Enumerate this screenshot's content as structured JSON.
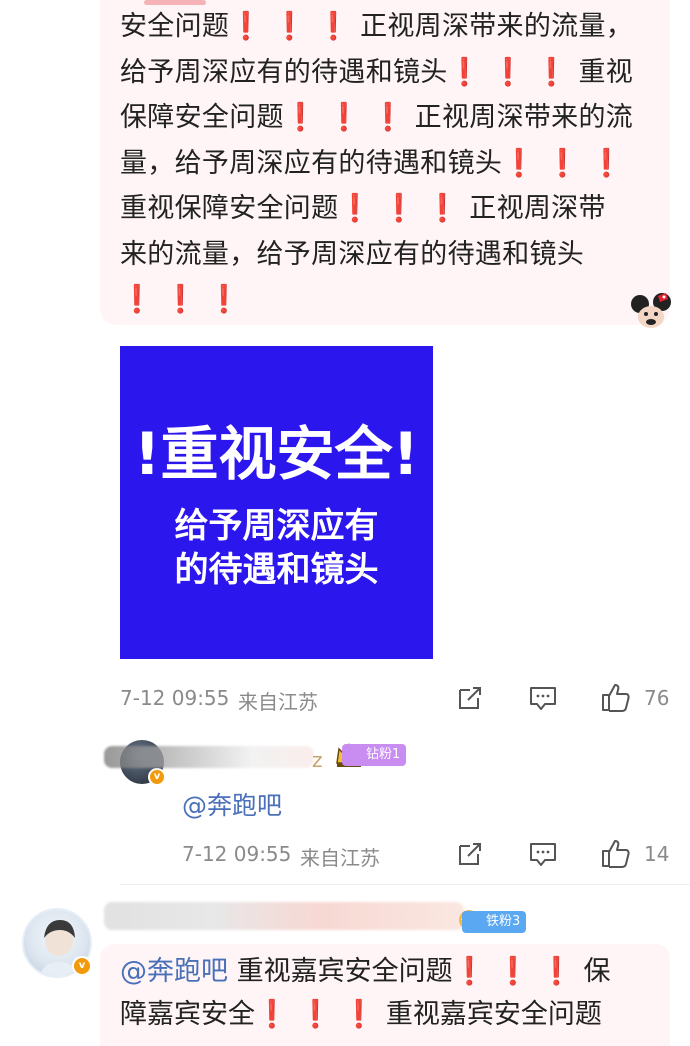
{
  "comment_top": {
    "lines": [
      [
        {
          "t": "安全问题"
        },
        {
          "b": "❗❗❗"
        },
        {
          "t": "正视周深带来的流量，"
        }
      ],
      [
        {
          "t": "给予周深应有的待遇和镜头"
        },
        {
          "b": "❗❗❗"
        },
        {
          "t": "重视"
        }
      ],
      [
        {
          "t": "保障安全问题"
        },
        {
          "b": "❗❗❗"
        },
        {
          "t": "正视周深带来的流"
        }
      ],
      [
        {
          "t": "量，给予周深应有的待遇和镜头"
        },
        {
          "b": "❗❗❗"
        }
      ],
      [
        {
          "t": "重视保障安全问题"
        },
        {
          "b": "❗❗❗"
        },
        {
          "t": "正视周深带"
        }
      ],
      [
        {
          "t": "来的流量，给予周深应有的待遇和镜头"
        }
      ],
      [
        {
          "b": "❗❗❗"
        }
      ]
    ],
    "image": {
      "big_text": "!重视安全!",
      "line1": "给予周深应有",
      "line2": "的待遇和镜头",
      "bg_color": "#2c16ee"
    },
    "time": "7-12 09:55",
    "source": "来自江苏",
    "like_count": "76"
  },
  "reply": {
    "name_fragment": "z",
    "fan_badge": "钻粉1",
    "mention": "@奔跑吧",
    "time": "7-12 09:55",
    "source": "来自江苏",
    "like_count": "14"
  },
  "comment_bottom": {
    "fan_badge": "铁粉3",
    "lines": [
      [
        {
          "m": "@奔跑吧"
        },
        {
          "t": " 重视嘉宾安全问题"
        },
        {
          "b": "❗❗❗"
        },
        {
          "t": "保"
        }
      ],
      [
        {
          "t": "障嘉宾安全"
        },
        {
          "b": "❗❗❗"
        },
        {
          "t": "重视嘉宾安全问题"
        }
      ]
    ]
  },
  "icons": {
    "share": "share-icon",
    "comment": "comment-icon",
    "like": "like-icon",
    "verified": "verified-badge-icon",
    "crown": "crown-icon",
    "sticker": "cartoon-mouse-sticker"
  },
  "colors": {
    "exclaim": "#e8212e",
    "mention": "#4a70b9",
    "bubble": "#fff5f6",
    "fan_badge_diamond": "#c98cf0",
    "fan_badge_iron": "#5aa7f2"
  }
}
